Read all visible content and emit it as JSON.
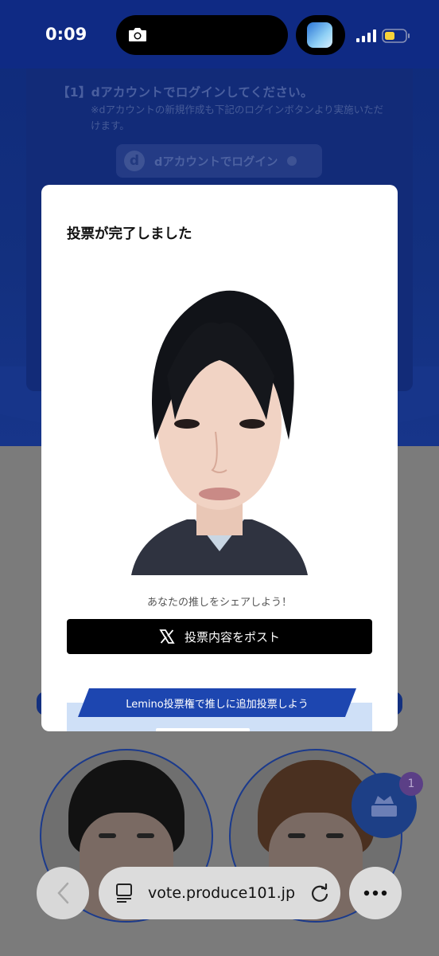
{
  "status_bar": {
    "time": "0:09",
    "battery_color": "#f7d23a"
  },
  "background_page": {
    "login_heading": "【1】dアカウントでログインしてください。",
    "login_note": "※dアカウントの新規作成も下記のログインボタンより実施いただけます。",
    "login_button_label": "dアカウントでログイン",
    "login_logo": "d",
    "fab_badge_count": "1"
  },
  "modal": {
    "title": "投票が完了しました",
    "share_prompt": "あなたの推しをシェアしよう！",
    "post_button_label": "投票内容をポスト",
    "lemino_banner": "Lemino投票権で推しに追加投票しよう"
  },
  "browser": {
    "url": "vote.produce101.jp",
    "back_icon": "chevron-left-icon",
    "page_icon": "page-menu-icon",
    "reload_icon": "reload-icon",
    "more_icon": "ellipsis-icon"
  },
  "colors": {
    "brand_blue": "#0f2a84",
    "post_button": "#000000",
    "lemino_ribbon": "#1d46b0"
  }
}
